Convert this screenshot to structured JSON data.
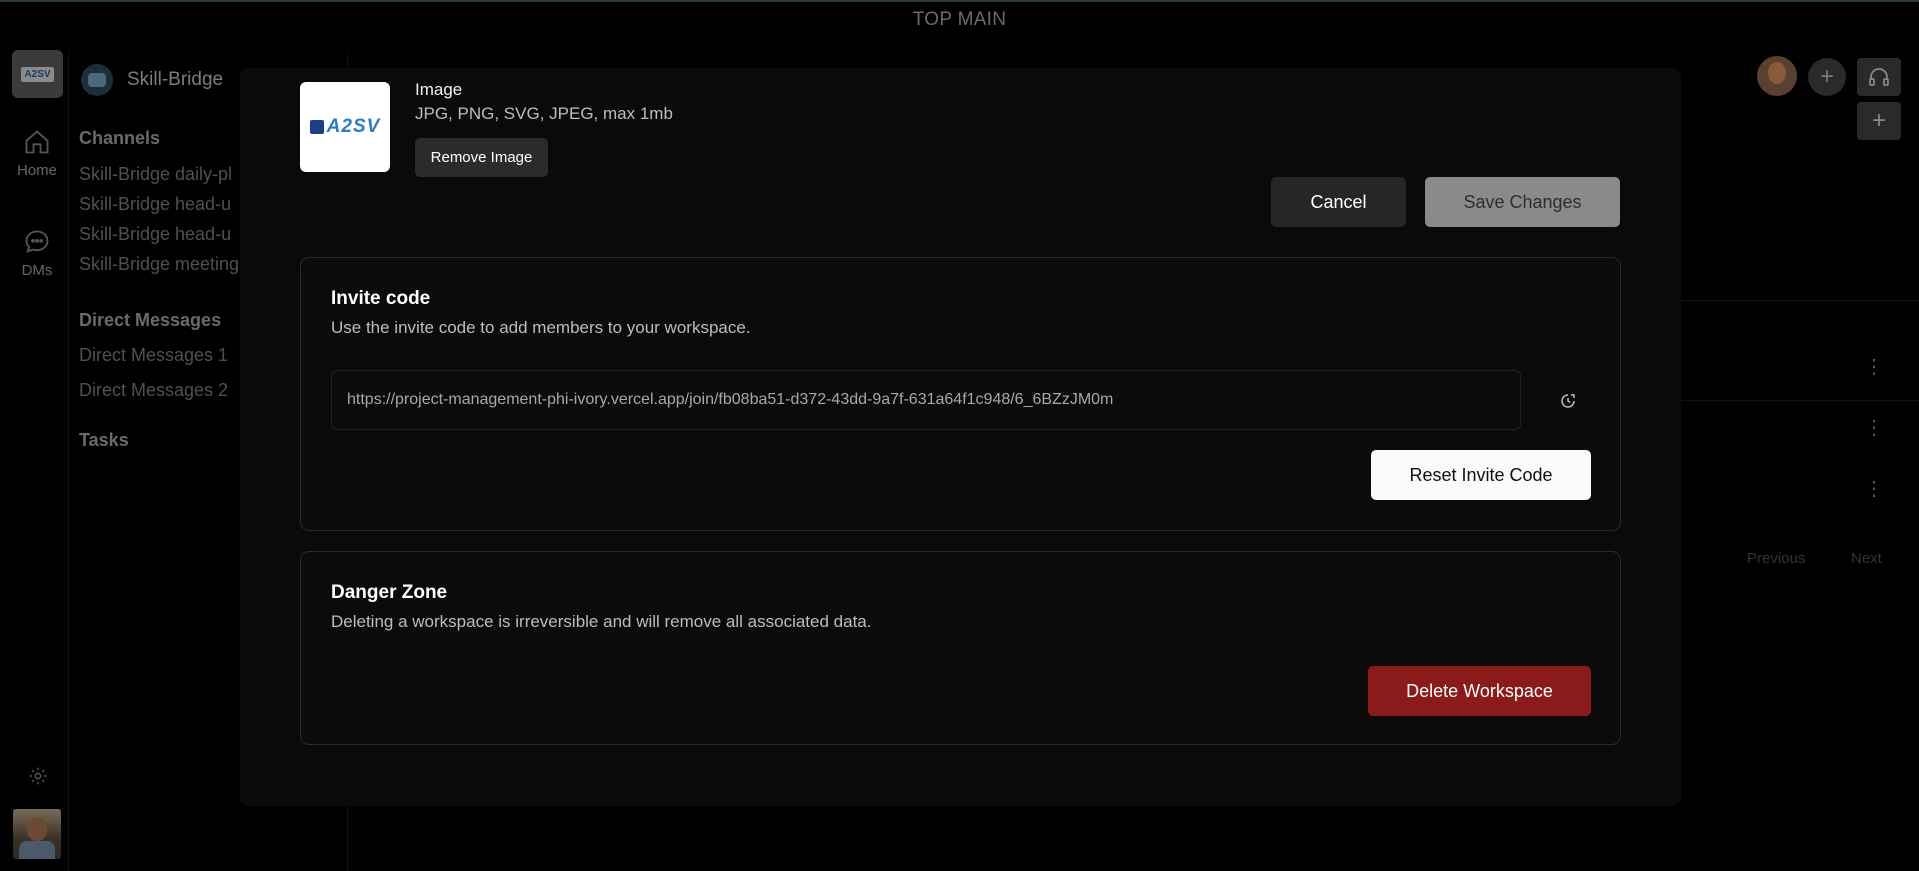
{
  "topbar": {
    "title": "TOP MAIN"
  },
  "rail": {
    "logo_text": "A2SV",
    "items": [
      {
        "label": "Home",
        "icon": "home-icon"
      },
      {
        "label": "DMs",
        "icon": "chat-icon"
      }
    ],
    "settings_icon": "gear-icon"
  },
  "sidebar": {
    "workspace_name": "Skill-Bridge",
    "channels_title": "Channels",
    "channels": [
      "Skill-Bridge daily-pl",
      "Skill-Bridge head-u",
      "Skill-Bridge head-u",
      "Skill-Bridge meeting"
    ],
    "dm_title": "Direct Messages",
    "dms": [
      "Direct Messages 1",
      "Direct Messages 2"
    ],
    "tasks_title": "Tasks"
  },
  "background": {
    "pagination": {
      "previous": "Previous",
      "next": "Next"
    }
  },
  "modal": {
    "image": {
      "logo_text": "A2SV",
      "title": "Image",
      "hint": "JPG, PNG, SVG, JPEG, max 1mb",
      "remove_label": "Remove Image"
    },
    "cancel_label": "Cancel",
    "save_label": "Save Changes",
    "invite": {
      "title": "Invite code",
      "description": "Use the invite code to add members to your workspace.",
      "url": "https://project-management-phi-ivory.vercel.app/join/fb08ba51-d372-43dd-9a7f-631a64f1c948/6_6BZzJM0m",
      "reset_label": "Reset Invite Code",
      "copy_icon": "copy-icon"
    },
    "danger": {
      "title": "Danger Zone",
      "description": "Deleting a workspace is irreversible and will remove all associated data.",
      "delete_label": "Delete Workspace"
    }
  },
  "colors": {
    "background": "#000000",
    "modal": "#0a0a0a",
    "danger": "#8b1a1a",
    "save_disabled": "#8a8a8a"
  }
}
